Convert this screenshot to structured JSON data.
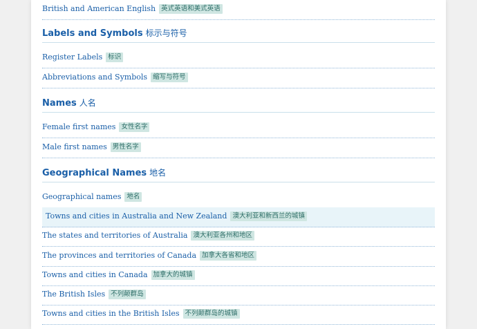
{
  "rows_top": {
    "british_american": {
      "en": "British and American English",
      "zh": "英式英语和美式英语"
    }
  },
  "sections": [
    {
      "title": "Labels and Symbols",
      "title_zh": "标示与符号",
      "items": [
        {
          "en": "Register Labels",
          "zh": "标识"
        },
        {
          "en": "Abbreviations and Symbols",
          "zh": "缩写与符号"
        }
      ]
    },
    {
      "title": "Names",
      "title_zh": "人名",
      "items": [
        {
          "en": "Female first names",
          "zh": "女性名字"
        },
        {
          "en": "Male first names",
          "zh": "男性名字"
        }
      ]
    },
    {
      "title": "Geographical Names",
      "title_zh": "地名",
      "items": [
        {
          "en": "Geographical names",
          "zh": "地名"
        },
        {
          "en": "Towns and cities in Australia and New Zealand",
          "zh": "澳大利亚和新西兰的城镇"
        },
        {
          "en": "The states and territories of Australia",
          "zh": "澳大利亚各州和地区"
        },
        {
          "en": "The provinces and territories of Canada",
          "zh": "加拿大各省和地区"
        },
        {
          "en": "Towns and cities in Canada",
          "zh": "加拿大的城镇"
        },
        {
          "en": "The British Isles",
          "zh": "不列颠群岛"
        },
        {
          "en": "Towns and cities in the British Isles",
          "zh": "不列颠群岛的城镇"
        }
      ]
    }
  ],
  "colors": {
    "link": "#1a5fa8",
    "badge_bg": "#cfe6e2",
    "highlight_bg": "#e8f4f9"
  }
}
